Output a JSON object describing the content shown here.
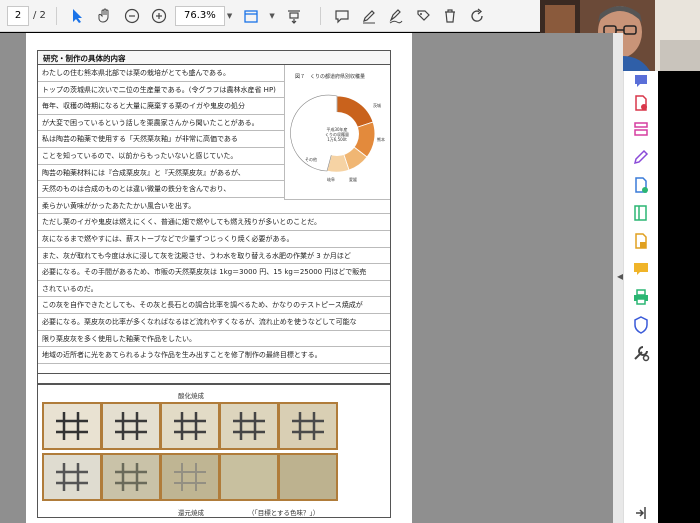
{
  "toolbar": {
    "current_page": "2",
    "total_pages": "/ 2",
    "zoom": "76.3%",
    "icons": [
      "select-arrow-icon",
      "hand-tool-icon",
      "zoom-out-icon",
      "zoom-in-icon",
      "page-fit-icon",
      "scroll-mode-icon",
      "comment-icon",
      "highlight-pen-icon",
      "sign-icon",
      "stamp-icon",
      "delete-icon",
      "rotate-icon"
    ]
  },
  "document": {
    "section_title": "研究・制作の具体的内容",
    "rows_upper": [
      "わたしの住む熊本県北部では栗の栽培がとても盛んである。",
      "トップの茨城県に次いで二位の生産量である。(令グラフは農林水産省 HP)",
      "毎年、収穫の時期になると大量に廃棄する栗のイガや鬼皮の処分",
      "が大変で困っているという話しを栗農家さんから聞いたことがある。",
      "私は陶芸の釉薬で使用する「天然栗灰釉」が非常に高価である",
      "ことを知っているので、以前からもったいないと感じていた。",
      "陶芸の釉薬材料には『合成栗皮灰』と『天然栗皮灰』があるが、",
      "天然のものは合成のものとは違い微量の鉄分を含んでおり、"
    ],
    "rows_lower": [
      "柔らかい黄味がかったあたたかい風合いを出す。",
      "ただし栗のイガや鬼皮は燃えにくく、普通に畑で燃やしても燃え残りが多いとのことだ。",
      "灰になるまで燃やすには、薪ストーブなどで少量ずつじっくり焼く必要がある。",
      "また、灰が取れても今度は水に浸して灰を沈殿させ、うわ水を取り替える水肥の作業が 3 か月ほど",
      "必要になる。その手間があるため、市販の天然栗皮灰は 1kg＝3000 円、15 kg＝25000 円ほどで販売",
      "されているのだ。",
      "この灰を自作できたとしても、その灰と長石との調合比率を調べるため、かなりのテストピース焼成が",
      "必要になる。栗皮灰の比率が多くなればなるほど流れやすくなるが、流れ止めを使うなどして可能な",
      "限り栗皮灰を多く使用した釉薬で作品をしたい。",
      "地域の近所者に光をあてられるような作品を生み出すことを修了制作の最終目標とする。"
    ],
    "figure_title": "図７　くりの都道府県別収穫量",
    "figure_center": "平成30年産\nくりの収穫量\n1万6,500t\n(全国計)",
    "figure_labels": [
      "茨城",
      "熊本",
      "愛媛",
      "岐阜",
      "その他"
    ],
    "photo_caption_top": "酸化焼成",
    "photo_caption_bottom": "還元焼成",
    "photo_caption_note": "（「目標とする色味？」）"
  },
  "right_rail": {
    "icons": [
      "comment-list-icon",
      "pdf-export-icon",
      "organize-pages-icon",
      "edit-pdf-icon",
      "create-pdf-icon",
      "scan-icon",
      "fill-sign-icon",
      "comment-icon",
      "print-icon",
      "protect-icon",
      "more-tools-icon"
    ],
    "bottom_icon": "collapse-panel-icon"
  }
}
